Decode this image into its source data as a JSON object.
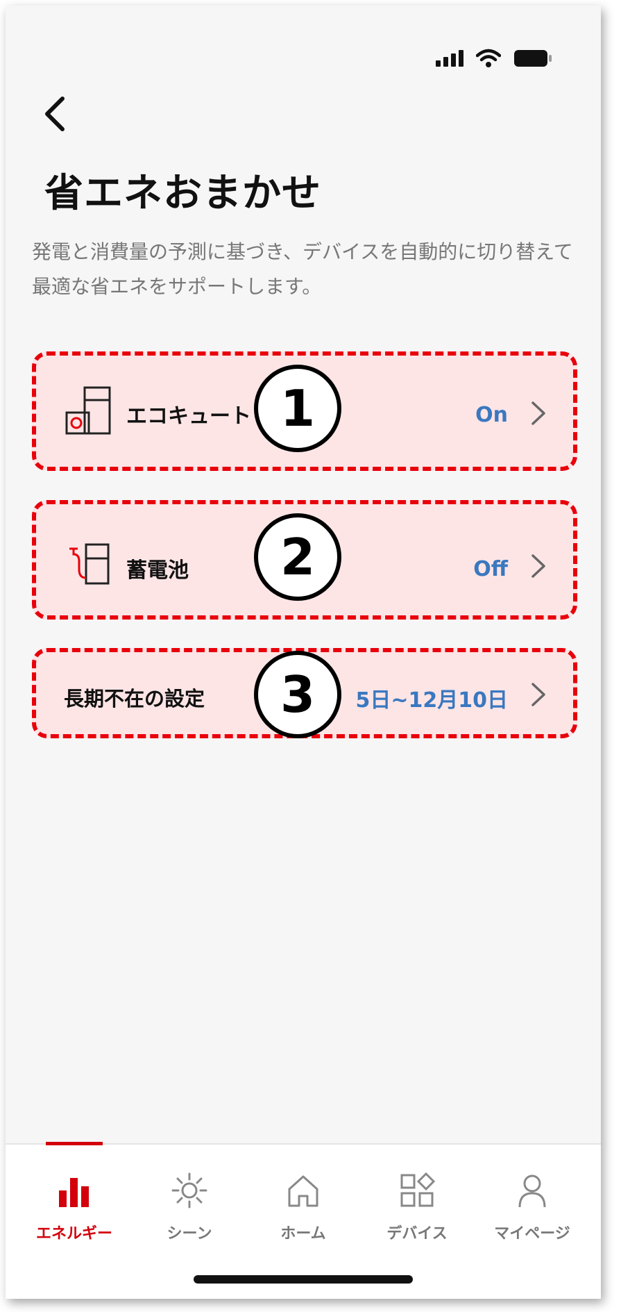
{
  "header": {
    "title": "省エネおまかせ",
    "description": "発電と消費量の予測に基づき、デバイスを自動的に切り替えて最適な省エネをサポートします。"
  },
  "items": [
    {
      "label": "エコキュート",
      "value": "On",
      "badge": "1"
    },
    {
      "label": "蓄電池",
      "value": "Off",
      "badge": "2"
    },
    {
      "label": "長期不在の設定",
      "value": "5日~12月10日",
      "badge": "3"
    }
  ],
  "tabs": [
    {
      "label": "エネルギー",
      "icon": "bar-chart-icon",
      "active": true
    },
    {
      "label": "シーン",
      "icon": "sun-icon"
    },
    {
      "label": "ホーム",
      "icon": "home-icon"
    },
    {
      "label": "デバイス",
      "icon": "devices-grid-icon"
    },
    {
      "label": "マイページ",
      "icon": "person-icon"
    }
  ],
  "colors": {
    "accent": "#d3000b",
    "highlight_border": "#e8000b",
    "highlight_fill": "#fde5e6",
    "value_blue": "#3a78c0"
  }
}
